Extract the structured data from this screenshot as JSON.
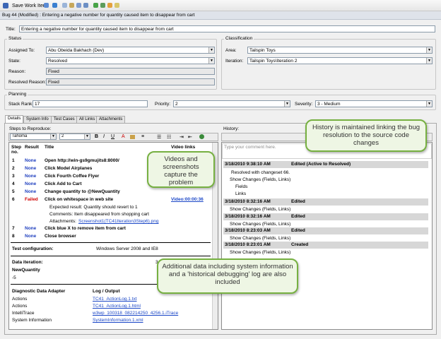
{
  "toolbar": {
    "save_label": "Save Work Item"
  },
  "title_bar": "Bug 44 (Modified) : Entering a negative number for quantity caused item to disappear from cart",
  "title": {
    "label": "Title:",
    "value": "Entering a negative number for quantity caused item to disappear from cart"
  },
  "status": {
    "group_label": "Status",
    "assigned_to": {
      "label": "Assigned To:",
      "value": "Abu Obeida Bakhach (Dev)"
    },
    "state": {
      "label": "State:",
      "value": "Resolved"
    },
    "reason": {
      "label": "Reason:",
      "value": "Fixed"
    },
    "resolved_reason": {
      "label": "Resolved Reason:",
      "value": "Fixed"
    }
  },
  "classification": {
    "group_label": "Classification",
    "area": {
      "label": "Area:",
      "value": "Tailspin Toys"
    },
    "iteration": {
      "label": "Iteration:",
      "value": "Tailspin Toys\\Iteration 2"
    }
  },
  "planning": {
    "group_label": "Planning",
    "stack_rank": {
      "label": "Stack Rank:",
      "value": "17"
    },
    "priority": {
      "label": "Priority:",
      "value": "2"
    },
    "severity": {
      "label": "Severity:",
      "value": "3 - Medium"
    }
  },
  "tabs": [
    "Details",
    "System Info",
    "Test Cases",
    "All Links",
    "Attachments"
  ],
  "steps": {
    "label": "Steps to Reproduce:",
    "font": "Tahoma",
    "font_size": "2",
    "headers": {
      "step": "Step",
      "step2": "no.",
      "result": "Result",
      "title": "Title",
      "video": "Video links"
    },
    "rows": [
      {
        "no": "1",
        "result": "None",
        "title": "Open http://win-gs9gmujits8:8000/"
      },
      {
        "no": "2",
        "result": "None",
        "title": "Click Model Airplanes"
      },
      {
        "no": "3",
        "result": "None",
        "title": "Click Fourth Coffee Flyer"
      },
      {
        "no": "4",
        "result": "None",
        "title": "Click Add to Cart"
      },
      {
        "no": "5",
        "result": "None",
        "title": "Change quantity to @NewQuantity"
      },
      {
        "no": "6",
        "result": "Failed",
        "title": "Click on whitespace in web site",
        "video": "Video:00:00:36"
      },
      {
        "no": "7",
        "result": "None",
        "title": "Click blue X to remove item from cart"
      },
      {
        "no": "8",
        "result": "None",
        "title": "Close browser"
      }
    ],
    "expected": "Expected result: Quantity should revert to 1",
    "comments": "Comments: Item disappeared from shopping cart",
    "attachments_label": "Attachments:",
    "attachment_file": "Screenshot1(TC41Iteration3Step6).png",
    "test_config_label": "Test configuration:",
    "test_config_value": "Windows Server 2008 and IE8",
    "data_iteration_label": "Data iteration:",
    "data_iteration_value": "3 of 3",
    "param_name": "NewQuantity",
    "param_value": "-5",
    "adapter_header": "Diagnostic Data Adapter",
    "log_header": "Log / Output",
    "adapters": [
      {
        "name": "Actions",
        "log": "TC41_ActionLog.1.txt"
      },
      {
        "name": "Actions",
        "log": "TC41_ActionLog.1.html"
      },
      {
        "name": "IntelliTrace",
        "log": "w3wp_100318_082214250_4256.1.iTrace"
      },
      {
        "name": "System Information",
        "log": "SystemInformation.1.xml"
      }
    ]
  },
  "history": {
    "label": "History:",
    "comment_placeholder": "Type your comment here.",
    "entries": [
      {
        "date": "3/18/2010 9:38:10 AM",
        "action": "Edited (Active to Resolved)"
      },
      {
        "date": "3/18/2010 8:32:16 AM",
        "action": "Edited"
      },
      {
        "date": "3/18/2010 8:32:16 AM",
        "action": "Edited"
      },
      {
        "date": "3/18/2010 8:23:03 AM",
        "action": "Edited"
      },
      {
        "date": "3/18/2010 8:23:01 AM",
        "action": "Created"
      }
    ],
    "changeset": "Resolved with changeset 66.",
    "show_changes": "Show Changes (Fields, Links)",
    "fields": "Fields",
    "links": "Links"
  },
  "callouts": {
    "videos": "Videos and screenshots capture the problem",
    "history": "History is maintained linking the bug resolution to the source code changes",
    "additional": "Additional data including system information and a 'historical debugging' log are also included"
  },
  "colors": {
    "failed": "#d00000",
    "none": "#1f3fbf",
    "callout_border": "#76b041"
  }
}
